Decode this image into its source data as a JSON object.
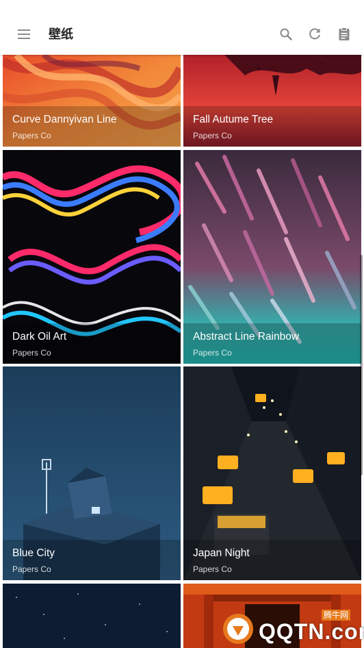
{
  "app_bar": {
    "title": "壁纸",
    "icons": {
      "menu": "hamburger-menu-icon",
      "search": "search-icon",
      "refresh": "refresh-icon",
      "clipboard": "clipboard-icon"
    }
  },
  "wallpapers": [
    {
      "title": "Curve Dannyivan Line",
      "author": "Papers Co"
    },
    {
      "title": "Fall Autume Tree",
      "author": "Papers Co"
    },
    {
      "title": "Dark Oil Art",
      "author": "Papers Co"
    },
    {
      "title": "Abstract Line Rainbow",
      "author": "Papers Co"
    },
    {
      "title": "Blue City",
      "author": "Papers Co"
    },
    {
      "title": "Japan Night",
      "author": "Papers Co"
    }
  ],
  "colors": {
    "app_bar_bg": "#ffffff",
    "icon_gray": "#8a8a8a",
    "watermark_orange": "#e67a1e"
  },
  "watermark": {
    "text": "QQTN.com",
    "sub": "腾牛网"
  }
}
